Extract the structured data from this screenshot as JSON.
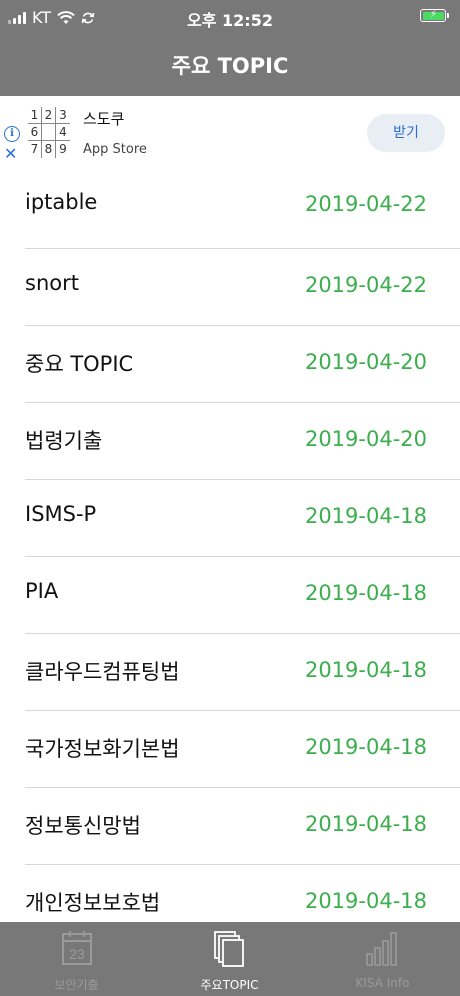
{
  "status_bar": {
    "carrier": "KT",
    "time": "오후 12:52"
  },
  "nav": {
    "title": "주요 TOPIC"
  },
  "ad": {
    "app_name": "스도쿠",
    "store": "App Store",
    "button": "받기",
    "sudoku_cells": [
      "1",
      "2",
      "3",
      "6",
      "",
      "4",
      "7",
      "8",
      "9"
    ]
  },
  "topics": [
    {
      "name": "iptable",
      "date": "2019-04-22"
    },
    {
      "name": "snort",
      "date": "2019-04-22"
    },
    {
      "name": "중요 TOPIC",
      "date": "2019-04-20"
    },
    {
      "name": "법령기출",
      "date": "2019-04-20"
    },
    {
      "name": "ISMS-P",
      "date": "2019-04-18"
    },
    {
      "name": "PIA",
      "date": "2019-04-18"
    },
    {
      "name": "클라우드컴퓨팅법",
      "date": "2019-04-18"
    },
    {
      "name": "국가정보화기본법",
      "date": "2019-04-18"
    },
    {
      "name": "정보통신망법",
      "date": "2019-04-18"
    },
    {
      "name": "개인정보보호법",
      "date": "2019-04-18"
    }
  ],
  "tabs": [
    {
      "label": "보안기출",
      "icon": "calendar-icon",
      "calendar_day": "23",
      "active": false
    },
    {
      "label": "주요TOPIC",
      "icon": "documents-icon",
      "active": true
    },
    {
      "label": "KISA Info",
      "icon": "bar-chart-icon",
      "active": false
    }
  ],
  "colors": {
    "bar_bg": "#787878",
    "date_green": "#3cae4e",
    "battery_green": "#4cd964",
    "ad_blue": "#2a6fd6"
  }
}
